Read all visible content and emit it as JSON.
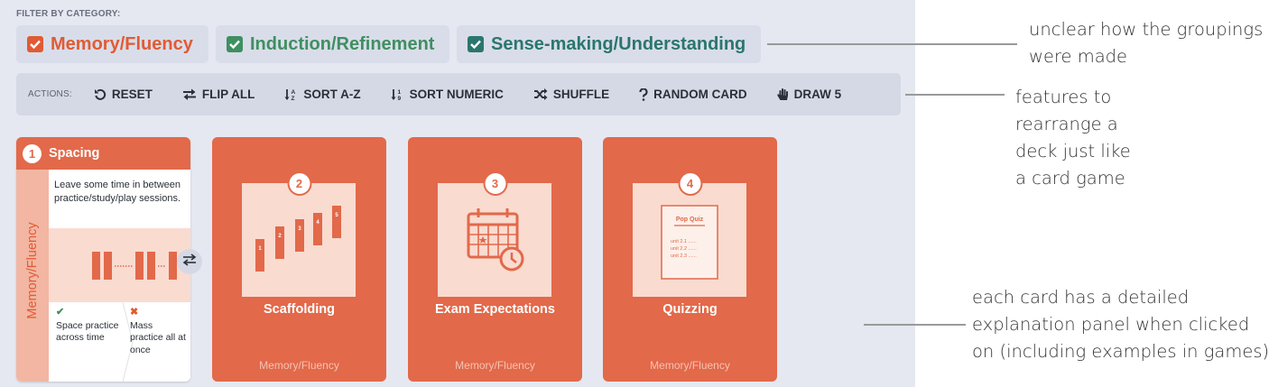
{
  "filter": {
    "label": "FILTER BY CATEGORY:",
    "categories": [
      {
        "label": "Memory/Fluency",
        "color": "#e05b34",
        "checked": true
      },
      {
        "label": "Induction/Refinement",
        "color": "#3f8f61",
        "checked": true
      },
      {
        "label": "Sense-making/Understanding",
        "color": "#2a766e",
        "checked": true
      }
    ]
  },
  "actions": {
    "label": "ACTIONS:",
    "items": [
      {
        "label": "RESET",
        "icon": "reset-icon"
      },
      {
        "label": "FLIP ALL",
        "icon": "flip-icon"
      },
      {
        "label": "SORT A-Z",
        "icon": "sort-alpha-icon"
      },
      {
        "label": "SORT NUMERIC",
        "icon": "sort-numeric-icon"
      },
      {
        "label": "SHUFFLE",
        "icon": "shuffle-icon"
      },
      {
        "label": "RANDOM CARD",
        "icon": "question-icon"
      },
      {
        "label": "DRAW 5",
        "icon": "hand-icon"
      }
    ]
  },
  "detail_card": {
    "number": "1",
    "title": "Spacing",
    "category": "Memory/Fluency",
    "description": "Leave some time in between practice/study/play sessions.",
    "do_mark": "✔",
    "do_text": "Space practice across time",
    "dont_mark": "✖",
    "dont_text": "Mass practice all at once",
    "flip_icon": "swap-icon"
  },
  "cards": [
    {
      "number": "2",
      "title": "Scaffolding",
      "category": "Memory/Fluency",
      "steps": [
        "1",
        "2",
        "3",
        "4",
        "5"
      ]
    },
    {
      "number": "3",
      "title": "Exam Expectations",
      "category": "Memory/Fluency"
    },
    {
      "number": "4",
      "title": "Quizzing",
      "category": "Memory/Fluency",
      "quiz_title": "Pop Quiz",
      "quiz_lines": [
        "unit 2.1 ......",
        "unit 2.2 ......",
        "unit 2.3 ......"
      ]
    }
  ],
  "annotations": {
    "groupings": [
      "unclear how the groupings",
      "were made"
    ],
    "features": [
      "features to",
      "rearrange a",
      "deck just like",
      "a card game"
    ],
    "panel": [
      "each card has a detailed",
      "explanation panel when clicked",
      "on (including examples in games)"
    ]
  },
  "colors": {
    "card": "#e2694a",
    "art_bg": "#fadbd0",
    "panel_bg": "#e5e8f1"
  }
}
